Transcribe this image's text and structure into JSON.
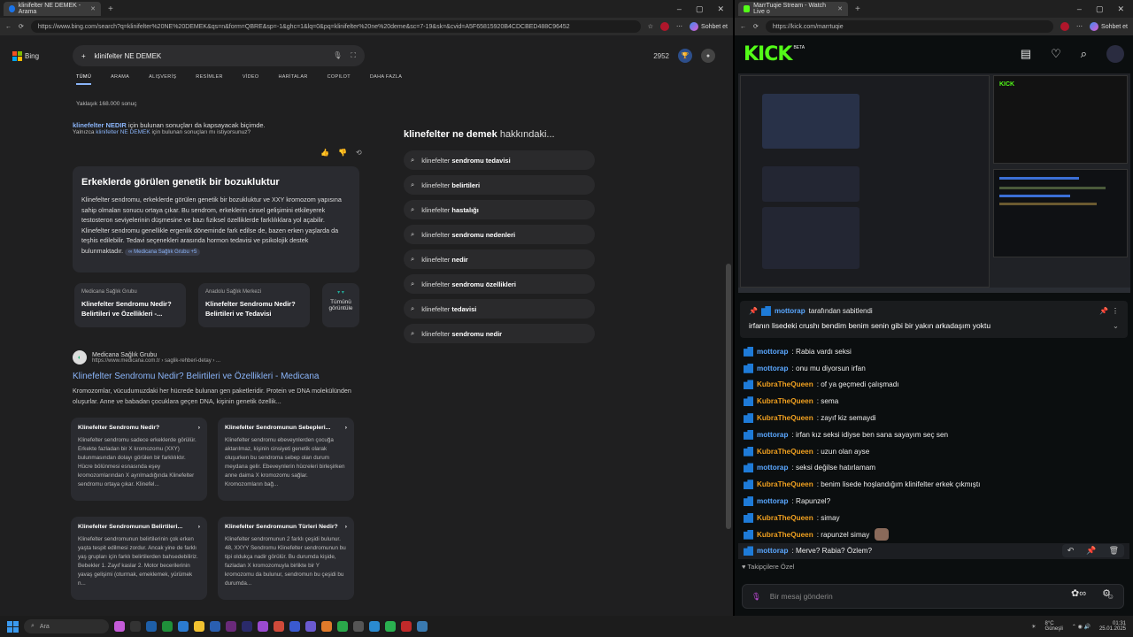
{
  "left_browser": {
    "tab_title": "klinifelter NE DEMEK - Arama",
    "url": "https://www.bing.com/search?q=klinifelter%20NE%20DEMEK&qs=n&form=QBRE&sp=-1&ghc=1&lq=0&pq=klinifelter%20ne%20deme&sc=7-19&sk=&cvid=A5F65815920B4CDCBED488C96452",
    "chat_label": "Sohbet et"
  },
  "bing": {
    "logo": "Bing",
    "query": "klinifelter NE DEMEK",
    "reward_points": "2952",
    "tabs": [
      "TÜMÜ",
      "ARAMA",
      "ALIŞVERİŞ",
      "RESİMLER",
      "VİDEO",
      "HARİTALAR",
      "COPILOT",
      "DAHA FAZLA"
    ],
    "result_count": "Yaklaşık 168.000 sonuç",
    "spell_line1_bold": "klinefelter NEDIR",
    "spell_line1_rest": " için bulunan sonuçları da kapsayacak biçimde.",
    "spell_line2_pre": "Yalnızca ",
    "spell_line2_link": "klinifelter NE DEMEK",
    "spell_line2_post": " için bulunan sonuçları mı istiyorsunuz?",
    "answer_title": "Erkeklerde görülen genetik bir bozukluktur",
    "answer_body": "Klinefelter sendromu, erkeklerde görülen genetik bir bozukluktur ve XXY kromozom yapısına sahip olmaları sonucu ortaya çıkar. Bu sendrom, erkeklerin cinsel gelişimini etkileyerek testosteron seviyelerinin düşmesine ve bazı fiziksel özelliklerde farklılıklara yol açabilir. Klinefelter sendromu genellikle ergenlik döneminde fark edilse de, bazen erken yaşlarda da teşhis edilebilir. Tedavi seçenekleri arasında hormon tedavisi ve psikolojik destek bulunmaktadır.",
    "answer_source": "Medicana Sağlık Grubu",
    "answer_more": "+5",
    "source_cards": [
      {
        "site": "Medicana Sağlık Grubu",
        "title": "Klinefelter Sendromu Nedir? Belirtileri ve Özellikleri -..."
      },
      {
        "site": "Anadolu Sağlık Merkezi",
        "title": "Klinefelter Sendromu Nedir? Belirtileri ve Tedavisi"
      },
      {
        "site": "",
        "title": "Tümünü görüntüle"
      }
    ],
    "result": {
      "site": "Medicana Sağlık Grubu",
      "url": "https://www.medicana.com.tr › saglik-rehberi-detay › ...",
      "title": "Klinefelter Sendromu Nedir? Belirtileri ve Özellikleri - Medicana",
      "snippet": "Kromozomlar, vücudumuzdaki her hücrede bulunan gen paketleridir. Protein ve DNA molekülünden oluşurlar. Anne ve babadan çocuklara geçen DNA, kişinin genetik özellik..."
    },
    "faq": [
      {
        "q": "Klinefelter Sendromu Nedir?",
        "a": "Klinefelter sendromu sadece erkeklerde görülür. Erkekte fazladan bir X kromozomu (XXY) bulunmasından dolayı görülen bir farklılıktır. Hücre bölünmesi esnasında eşey kromozomlarından X ayrılmadığında Klinefelter sendromu ortaya çıkar. Klinefel..."
      },
      {
        "q": "Klinefelter Sendromunun Sebepleri...",
        "a": "Klinefelter sendromu ebeveynlerden çocuğa aktarılmaz, kişinin cinsiyeti genetik olarak oluşurken bu sendroma sebep olan durum meydana gelir. Ebeveynlerin hücreleri birleşirken anne daima X kromozomu sağlar. Kromozomların bağ..."
      },
      {
        "q": "Klinefelter Sendromunun Belirtileri...",
        "a": "Klinefelter sendromunun belirtilerinin çok erken yaşta tespit edilmesi zordur. Ancak yine de farklı yaş grupları için farklı belirtilerden bahsedebiliriz. Bebekler 1. Zayıf kaslar 2. Motor becerilerinin yavaş gelişimi (oturmak, emeklemek, yürümek n..."
      },
      {
        "q": "Klinefelter Sendromunun Türleri Nedir?",
        "a": "Klinefelter sendromunun 2 farklı çeşidi bulunur. 48, XXYY Sendromu Klinefelter sendromunun bu tipi oldukça nadir görülür. Bu durumda kişide, fazladan X kromozomuyla birlikte bir Y kromozomu da bulunur, sendromun bu çeşidi bu durumda..."
      }
    ],
    "related_heading_bold": "klinefelter ne demek",
    "related_heading_rest": " hakkındaki...",
    "related": [
      {
        "pre": "klinefelter ",
        "bold": "sendromu tedavisi"
      },
      {
        "pre": "klinefelter ",
        "bold": "belirtileri"
      },
      {
        "pre": "klinefelter ",
        "bold": "hastalığı"
      },
      {
        "pre": "klinefelter ",
        "bold": "sendromu nedenleri"
      },
      {
        "pre": "klinefelter ",
        "bold": "nedir"
      },
      {
        "pre": "klinefelter ",
        "bold": "sendromu özellikleri"
      },
      {
        "pre": "klinefelter ",
        "bold": "tedavisi"
      },
      {
        "pre": "klinefelter ",
        "bold": "sendromu nedir"
      }
    ]
  },
  "right_browser": {
    "tab_title": "MarrTuqie Stream - Watch Live o",
    "url": "https://kick.com/marrtuqie",
    "chat_label": "Sohbet et"
  },
  "kick": {
    "logo": "KICK",
    "logo_tag": "BETA",
    "pinned_user": "mottorap",
    "pinned_by": "tarafından sabitlendi",
    "pinned_msg": "irfanın lisedeki crushı bendim benim senin gibi bir yakın arkadaşım yoktu",
    "messages": [
      {
        "user": "mottorap",
        "text": ": Rabia vardı seksi",
        "kind": "u1"
      },
      {
        "user": "mottorap",
        "text": ": onu mu diyorsun irfan",
        "kind": "u1"
      },
      {
        "user": "KubraTheQueen",
        "text": ": of ya geçmedi çalışmadı",
        "kind": "u2"
      },
      {
        "user": "KubraTheQueen",
        "text": ": sema",
        "kind": "u2"
      },
      {
        "user": "KubraTheQueen",
        "text": ": zayıf kiz semaydi",
        "kind": "u2"
      },
      {
        "user": "mottorap",
        "text": ": irfan kız seksi idiyse ben sana sayayım seç sen",
        "kind": "u1"
      },
      {
        "user": "KubraTheQueen",
        "text": ": uzun olan ayse",
        "kind": "u2"
      },
      {
        "user": "mottorap",
        "text": ": seksi değilse hatırlamam",
        "kind": "u1"
      },
      {
        "user": "KubraTheQueen",
        "text": ": benim lisede hoşlandığım klinifelter erkek çıkmıştı",
        "kind": "u2"
      },
      {
        "user": "mottorap",
        "text": ": Rapunzel?",
        "kind": "u1"
      },
      {
        "user": "KubraTheQueen",
        "text": ": simay",
        "kind": "u2"
      },
      {
        "user": "KubraTheQueen",
        "text": ": rapunzel simay",
        "kind": "u2"
      },
      {
        "user": "mottorap",
        "text": ": Merve? Rabia? Özlem?",
        "kind": "u1"
      }
    ],
    "followers_only": "Takipçilere Özel",
    "input_placeholder": "Bir mesaj gönderin"
  },
  "taskbar": {
    "search": "Ara",
    "weather_temp": "8°C",
    "weather_desc": "Güneşli",
    "time": "01:31",
    "date": "25.01.2025"
  }
}
